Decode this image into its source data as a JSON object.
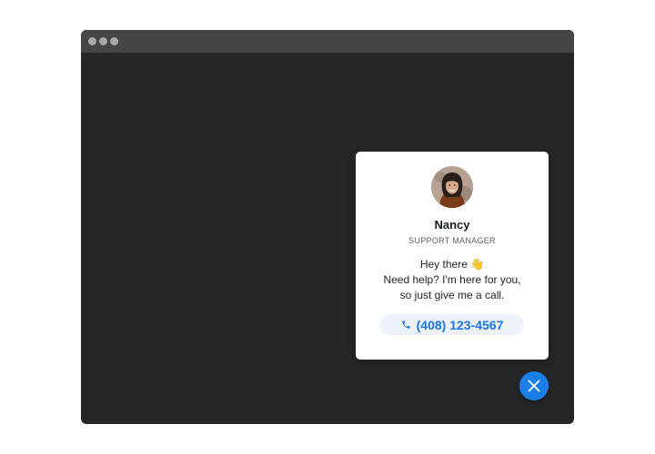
{
  "window": {
    "title_bar_dots": [
      "dot",
      "dot",
      "dot"
    ]
  },
  "contact_card": {
    "name": "Nancy",
    "role": "SUPPORT MANAGER",
    "greeting_lines": [
      "Hey there 👋",
      "Need help? I'm here for you,",
      "so just give me a call."
    ],
    "phone": "(408) 123-4567",
    "phone_icon": "phone-icon",
    "avatar_icon": "avatar-photo"
  },
  "close_button": {
    "icon": "close-icon"
  },
  "colors": {
    "accent": "#1a7fe8",
    "window_bg": "#252627",
    "title_bar": "#444546",
    "phone_pill_bg": "#eef3fb"
  }
}
